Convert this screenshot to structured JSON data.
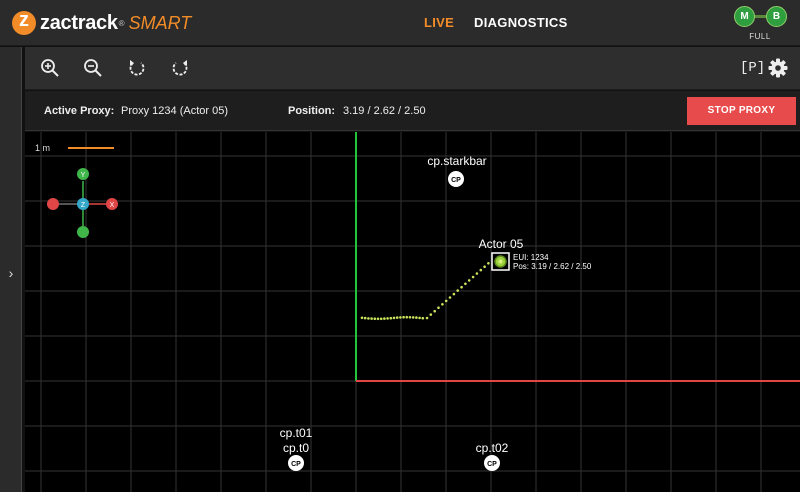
{
  "app": {
    "logo_name": "zactrack",
    "logo_sup": "®",
    "logo_product": "SMART",
    "brand_color": "#f28c28"
  },
  "nav": {
    "live": "LIVE",
    "diagnostics": "DIAGNOSTICS",
    "active": "live"
  },
  "status": {
    "m": "M",
    "b": "B",
    "mode": "FULL",
    "color": "#2e9e3e"
  },
  "sidebar": {
    "toggle_icon": "chevron-right-icon",
    "toggle_glyph": "›"
  },
  "toolbar": {
    "icons": [
      "zoom-in-icon",
      "zoom-out-icon",
      "rotate-left-icon",
      "rotate-right-icon",
      "proxy-bracket-icon",
      "gear-icon"
    ],
    "proxy_glyph": "[P]"
  },
  "info": {
    "active_proxy_label": "Active Proxy:",
    "active_proxy_value": "Proxy 1234 (Actor 05)",
    "position_label": "Position:",
    "position_value": "3.19 / 2.62 / 2.50",
    "stop_button": "STOP PROXY",
    "stop_color": "#e84b4b"
  },
  "map": {
    "scale_label": "1 m",
    "axis_y": "Y",
    "axis_z": "Z",
    "axis_x": "X",
    "actor": {
      "name": "Actor 05",
      "eui": "EUI: 1234",
      "pos": "Pos: 3.19 / 2.62 / 2.50"
    },
    "checkpoints": [
      {
        "name": "cp.starkbar",
        "badge": "CP"
      },
      {
        "name": "cp.t01",
        "sub": "cp.t0",
        "badge": "CP"
      },
      {
        "name": "cp.t02",
        "badge": "CP"
      }
    ],
    "colors": {
      "grid": "#333333",
      "y_axis": "#22c53a",
      "x_axis": "#e04646",
      "trail": "#c9e35a"
    }
  }
}
